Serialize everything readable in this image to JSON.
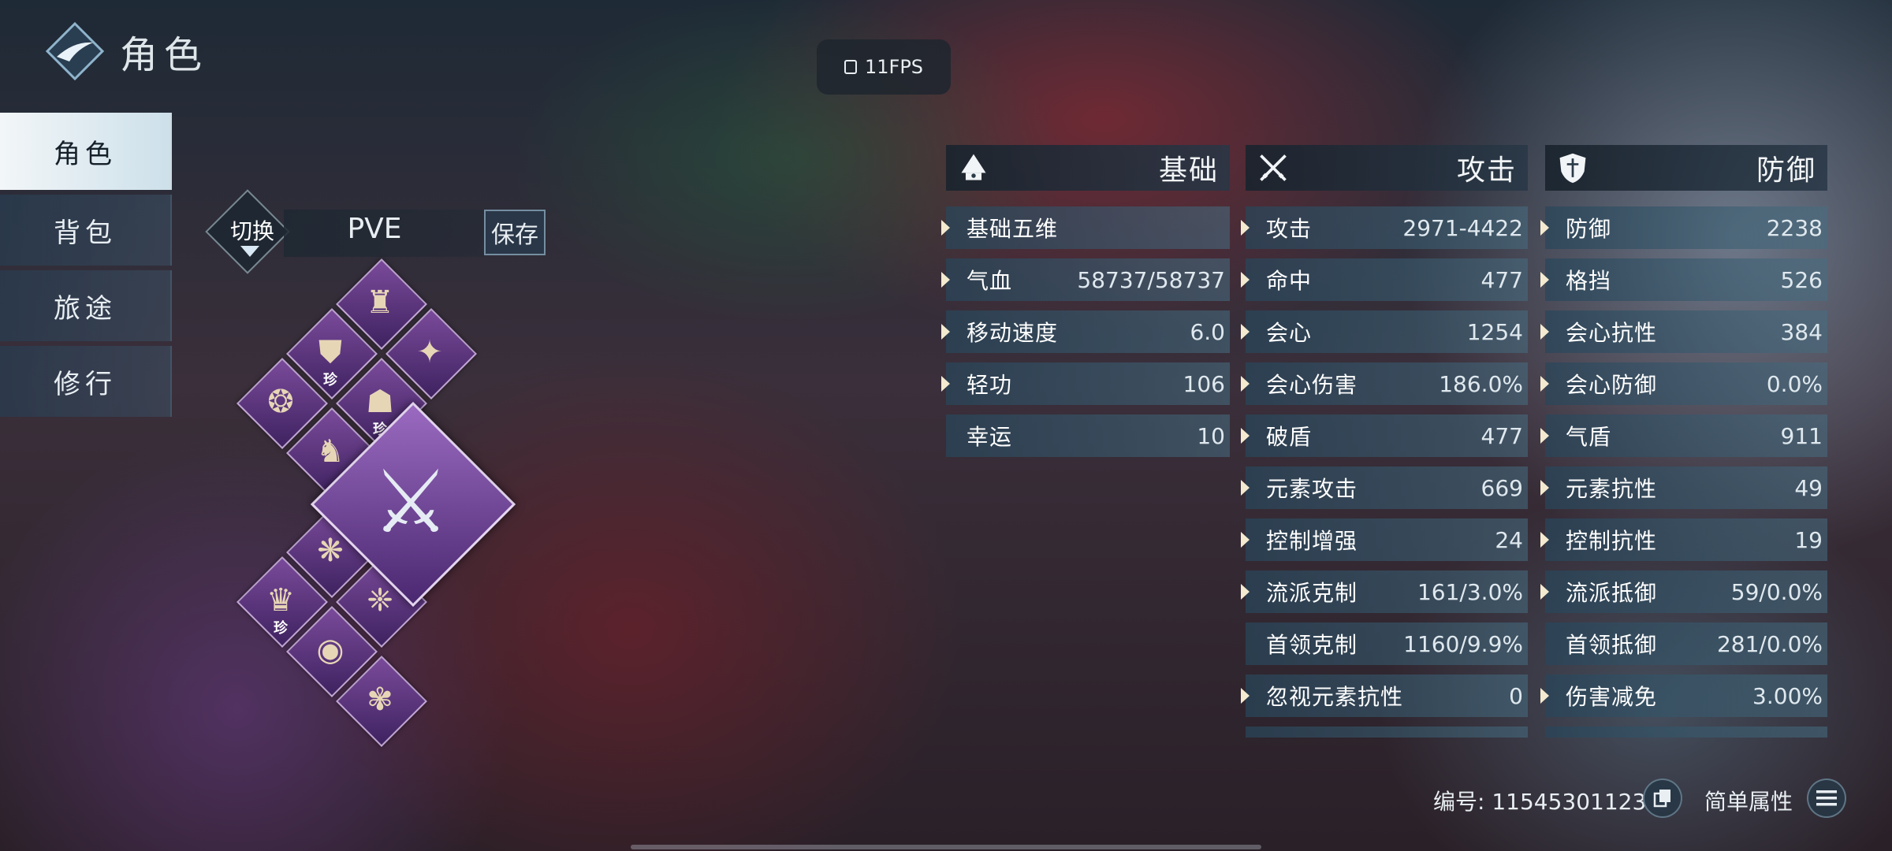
{
  "header": {
    "title": "角色",
    "logo_icon": "diamond-swoosh-logo"
  },
  "fps": {
    "label": "11FPS"
  },
  "nav": {
    "items": [
      {
        "label": "角色",
        "active": true
      },
      {
        "label": "背包",
        "active": false
      },
      {
        "label": "旅途",
        "active": false
      },
      {
        "label": "修行",
        "active": false
      }
    ]
  },
  "loadout": {
    "switch_label": "切换",
    "mode": "PVE",
    "save_label": "保存"
  },
  "equipment": {
    "rare_badge": "珍",
    "slots": [
      {
        "name": "helmet-slot",
        "icon": "helmet-icon",
        "rare": false
      },
      {
        "name": "shoulder-slot",
        "icon": "shoulder-armor-icon",
        "rare": true
      },
      {
        "name": "bracer-slot",
        "icon": "bracer-icon",
        "rare": false
      },
      {
        "name": "belt-slot",
        "icon": "belt-icon",
        "rare": false
      },
      {
        "name": "chest-slot",
        "icon": "chest-armor-icon",
        "rare": true
      },
      {
        "name": "boots-slot",
        "icon": "boots-icon",
        "rare": false
      },
      {
        "name": "necklace-slot",
        "icon": "necklace-icon",
        "rare": false
      },
      {
        "name": "pendant-slot",
        "icon": "dragon-pendant-icon",
        "rare": true
      },
      {
        "name": "earring-slot",
        "icon": "earring-icon",
        "rare": false
      },
      {
        "name": "ring-slot",
        "icon": "ring-icon",
        "rare": false
      },
      {
        "name": "accessory-slot",
        "icon": "accessory-icon",
        "rare": false
      }
    ],
    "weapon": {
      "name": "weapon-slot",
      "icon": "sword-icon"
    }
  },
  "stats": {
    "basic": {
      "title": "基础",
      "icon": "hat-icon",
      "rows": [
        {
          "label": "基础五维",
          "value": "",
          "arrow": true
        },
        {
          "label": "气血",
          "value": "58737/58737",
          "arrow": true
        },
        {
          "label": "移动速度",
          "value": "6.0",
          "arrow": true
        },
        {
          "label": "轻功",
          "value": "106",
          "arrow": true
        },
        {
          "label": "幸运",
          "value": "10",
          "arrow": false
        }
      ]
    },
    "attack": {
      "title": "攻击",
      "icon": "crossed-swords-icon",
      "rows": [
        {
          "label": "攻击",
          "value": "2971-4422",
          "arrow": true
        },
        {
          "label": "命中",
          "value": "477",
          "arrow": true
        },
        {
          "label": "会心",
          "value": "1254",
          "arrow": true
        },
        {
          "label": "会心伤害",
          "value": "186.0%",
          "arrow": true
        },
        {
          "label": "破盾",
          "value": "477",
          "arrow": true
        },
        {
          "label": "元素攻击",
          "value": "669",
          "arrow": true
        },
        {
          "label": "控制增强",
          "value": "24",
          "arrow": true
        },
        {
          "label": "流派克制",
          "value": "161/3.0%",
          "arrow": true
        },
        {
          "label": "首领克制",
          "value": "1160/9.9%",
          "arrow": false
        },
        {
          "label": "忽视元素抗性",
          "value": "0",
          "arrow": true
        }
      ]
    },
    "defense": {
      "title": "防御",
      "icon": "shield-icon",
      "rows": [
        {
          "label": "防御",
          "value": "2238",
          "arrow": true
        },
        {
          "label": "格挡",
          "value": "526",
          "arrow": true
        },
        {
          "label": "会心抗性",
          "value": "384",
          "arrow": true
        },
        {
          "label": "会心防御",
          "value": "0.0%",
          "arrow": true
        },
        {
          "label": "气盾",
          "value": "911",
          "arrow": true
        },
        {
          "label": "元素抗性",
          "value": "49",
          "arrow": true
        },
        {
          "label": "控制抗性",
          "value": "19",
          "arrow": true
        },
        {
          "label": "流派抵御",
          "value": "59/0.0%",
          "arrow": true
        },
        {
          "label": "首领抵御",
          "value": "281/0.0%",
          "arrow": false
        },
        {
          "label": "伤害减免",
          "value": "3.00%",
          "arrow": true
        }
      ]
    }
  },
  "footer": {
    "id_label": "编号:",
    "id_value": "11545301123",
    "copy_icon": "copy-id-icon",
    "simple_label": "简单属性",
    "menu_icon": "hamburger-menu-icon"
  },
  "colors": {
    "accent": "#f4ead0",
    "slot_purple": "#7a4a9a",
    "panel_teal": "#46708a"
  }
}
